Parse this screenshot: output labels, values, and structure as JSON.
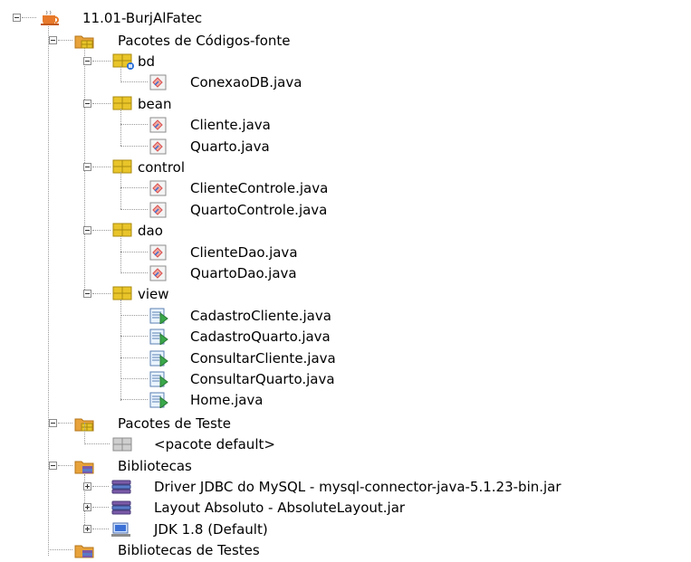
{
  "tree": {
    "project": "11.01-BurjAlFatec",
    "source_packages": "Pacotes de Códigos-fonte",
    "packages": [
      {
        "name": "bd",
        "files": [
          "ConexaoDB.java"
        ]
      },
      {
        "name": "bean",
        "files": [
          "Cliente.java",
          "Quarto.java"
        ]
      },
      {
        "name": "control",
        "files": [
          "ClienteControle.java",
          "QuartoControle.java"
        ]
      },
      {
        "name": "dao",
        "files": [
          "ClienteDao.java",
          "QuartoDao.java"
        ]
      },
      {
        "name": "view",
        "files": [
          "CadastroCliente.java",
          "CadastroQuarto.java",
          "ConsultarCliente.java",
          "ConsultarQuarto.java",
          "Home.java"
        ]
      }
    ],
    "test_packages": "Pacotes de Teste",
    "default_package": "<pacote default>",
    "libraries": "Bibliotecas",
    "library_items": [
      {
        "label": "Driver JDBC do MySQL - mysql-connector-java-5.1.23-bin.jar",
        "icon": "jar-library-icon"
      },
      {
        "label": "Layout Absoluto - AbsoluteLayout.jar",
        "icon": "jar-library-icon"
      },
      {
        "label": "JDK 1.8 (Default)",
        "icon": "jdk-platform-icon"
      }
    ],
    "test_libraries": "Bibliotecas de Testes"
  },
  "colors": {
    "folder": "#e8a23a",
    "package": "#e9c52a",
    "java_class": "#d94f4f",
    "form_green": "#3aa84a",
    "db_badge": "#2a6fd6"
  }
}
